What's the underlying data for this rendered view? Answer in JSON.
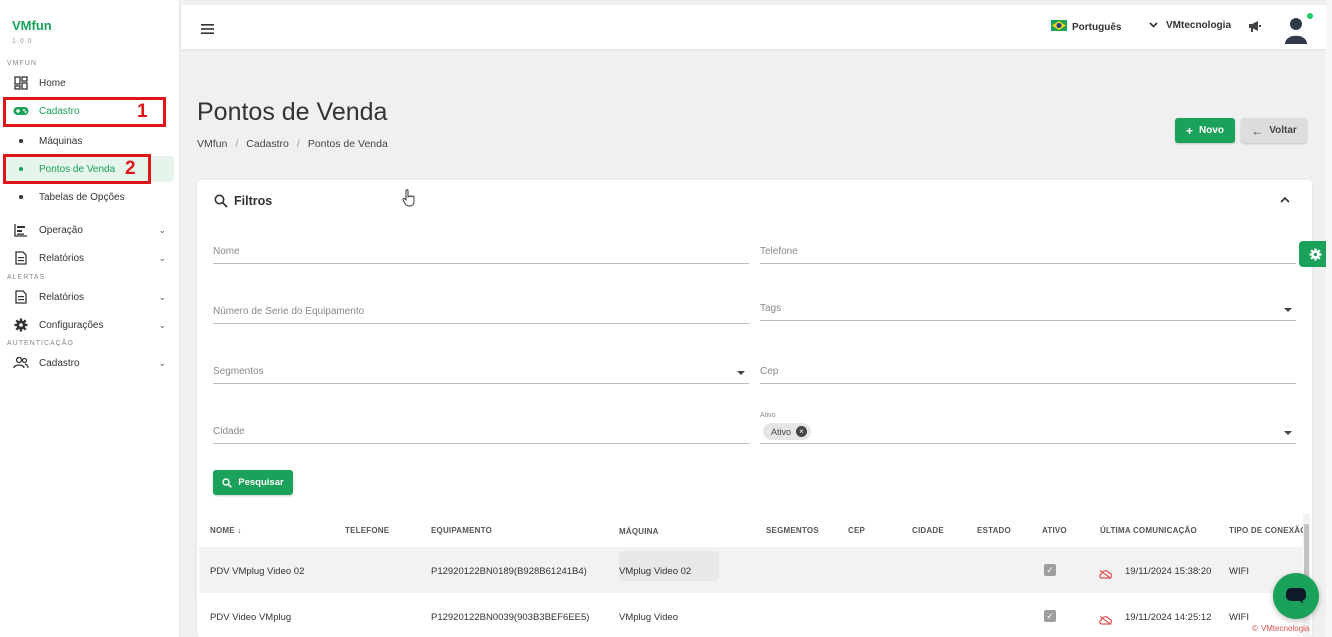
{
  "brand": {
    "name": "VMfun",
    "version": "1.0.0"
  },
  "sidebar": {
    "sections": [
      "VMFUN",
      "ALERTAS",
      "AUTENTICAÇÃO"
    ],
    "items": [
      {
        "label": "Home",
        "icon": "dashboard-icon"
      },
      {
        "label": "Cadastro",
        "icon": "gamepad-icon"
      },
      {
        "label": "Operação",
        "icon": "chart-icon"
      },
      {
        "label": "Relatórios",
        "icon": "document-icon"
      },
      {
        "label": "Relatórios",
        "icon": "document-icon"
      },
      {
        "label": "Configurações",
        "icon": "gear-icon"
      },
      {
        "label": "Cadastro",
        "icon": "users-icon"
      }
    ],
    "sub_items": [
      "Máquinas",
      "Pontos de Venda",
      "Tabelas de Opções"
    ],
    "annotations": [
      "1",
      "2"
    ]
  },
  "topbar": {
    "language": "Português",
    "organization": "VMtecnologia"
  },
  "page": {
    "title": "Pontos de Venda",
    "breadcrumb": [
      "VMfun",
      "Cadastro",
      "Pontos de Venda"
    ],
    "new_button": "Novo",
    "back_button": "Voltar"
  },
  "filters": {
    "title": "Filtros",
    "nome": "Nome",
    "telefone": "Telefone",
    "numero_serie": "Número de Serie do Equipamento",
    "tags": "Tags",
    "segmentos": "Segmentos",
    "cep": "Cep",
    "cidade": "Cidade",
    "ativo_label": "Ativo",
    "ativo_chip": "Ativo",
    "search_button": "Pesquisar"
  },
  "table": {
    "columns": [
      "NOME",
      "TELEFONE",
      "EQUIPAMENTO",
      "MÁQUINA",
      "SEGMENTOS",
      "CEP",
      "CIDADE",
      "ESTADO",
      "ATIVO",
      "ÚLTIMA COMUNICAÇÃO",
      "TIPO DE CONEXÃO"
    ],
    "rows": [
      {
        "nome": "PDV VMplug Video 02",
        "equipamento": "P12920122BN0189(B928B61241B4)",
        "maquina": "VMplug Video 02",
        "ultima": "19/11/2024 15:38:20",
        "tipo": "WIFI"
      },
      {
        "nome": "PDV Video VMplug",
        "equipamento": "P12920122BN0039(903B3BEF6EE5)",
        "maquina": "VMplug Video",
        "ultima": "19/11/2024 14:25:12",
        "tipo": "WIFI"
      }
    ]
  },
  "footer": {
    "brand": "VMtecnologia"
  },
  "colors": {
    "accent": "#1aa15a",
    "annotation": "#e0151a",
    "offline": "#d9534f"
  }
}
